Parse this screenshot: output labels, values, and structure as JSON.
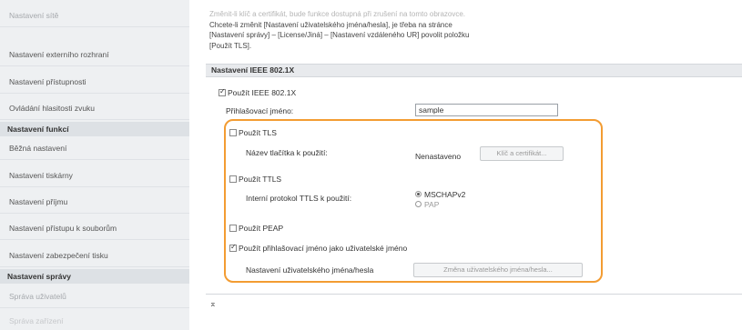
{
  "sidebar": {
    "items": [
      {
        "label": "Nastavení sítě",
        "style": "fade"
      },
      {
        "label": "Nastavení externího rozhraní",
        "style": ""
      },
      {
        "label": "Nastavení přístupnosti",
        "style": ""
      },
      {
        "label": "Ovládání hlasitosti zvuku",
        "style": ""
      }
    ],
    "section_functions": "Nastavení funkcí",
    "function_items": [
      {
        "label": "Běžná nastavení"
      },
      {
        "label": "Nastavení tiskárny"
      },
      {
        "label": "Nastavení příjmu"
      },
      {
        "label": "Nastavení přístupu k souborům"
      },
      {
        "label": "Nastavení zabezpečení tisku"
      }
    ],
    "section_management": "Nastavení správy",
    "management_items": [
      {
        "label": "Správa uživatelů",
        "style": "fade"
      },
      {
        "label": "Správa zařízení",
        "style": "fade2"
      }
    ]
  },
  "main": {
    "note_lines": [
      "Změnit-li klíč a certifikát, bude funkce dostupná při zrušení na tomto obrazovce.",
      "Chcete-li změnit [Nastavení uživatelského jména/hesla], je třeba na stránce",
      "[Nastavení správy] – [License/Jiná] – [Nastavení vzdáleného UR] povolit položku",
      "[Použít TLS]."
    ],
    "section_title": "Nastavení IEEE 802.1X",
    "use_ieee_label": "Použít IEEE 802.1X",
    "login_name_label": "Přihlašovací jméno:",
    "login_name_value": "sample",
    "use_tls_label": "Použít TLS",
    "key_label": "Název tlačítka k použití:",
    "key_status": "Nenastaveno",
    "key_button": "Klíč a certifikát...",
    "use_ttls_label": "Použít TTLS",
    "ttls_protocol_label": "Interní protokol TTLS k použití:",
    "ttls_options": [
      "MSCHAPv2",
      "PAP"
    ],
    "use_peap_label": "Použít PEAP",
    "use_login_as_user_label": "Použít přihlašovací jméno jako uživatelské jméno",
    "user_pass_label": "Nastavení uživatelského jména/hesla",
    "change_button": "Změna uživatelského jména/hesla...",
    "top_link": "⌅"
  },
  "colors": {
    "highlight": "#f39c32",
    "sidebar_bg": "#eef0f2",
    "section_bg": "#dde1e5"
  }
}
